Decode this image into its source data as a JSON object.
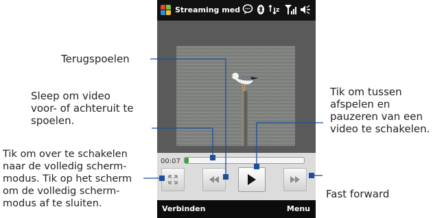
{
  "status_bar": {
    "title": "Streaming med",
    "icons": [
      "windows-logo",
      "chat-bubble-icon",
      "bluetooth-icon",
      "network-sync-icon",
      "signal-icon",
      "speaker-icon"
    ]
  },
  "player": {
    "elapsed_time": "00:07",
    "progress": 0.03,
    "buttons": [
      "fullscreen-button",
      "rewind-button",
      "play-button",
      "fast-forward-button"
    ]
  },
  "softkeys": {
    "left": "Verbinden",
    "right": "Menu"
  },
  "callouts": {
    "rewind": "Terugspoelen",
    "drag": [
      "Sleep om video",
      "voor- of achteruit te",
      "spoelen."
    ],
    "fullscreen": [
      "Tik om over te schakelen",
      "naar de volledig scherm-",
      "modus. Tik op het scherm",
      "om de volledig scherm-",
      "modus af te sluiten."
    ],
    "play": [
      "Tik om tussen",
      "afspelen en",
      "pauzeren van een",
      "video te schakelen."
    ],
    "fast_forward": "Fast forward"
  },
  "colors": {
    "callout_line": "#1a4f9a",
    "progress_fill": "#3ca33c",
    "phone_frame": "#000000",
    "screen_background": "#5a5a5a",
    "control_panel": "#dcdcdc"
  }
}
